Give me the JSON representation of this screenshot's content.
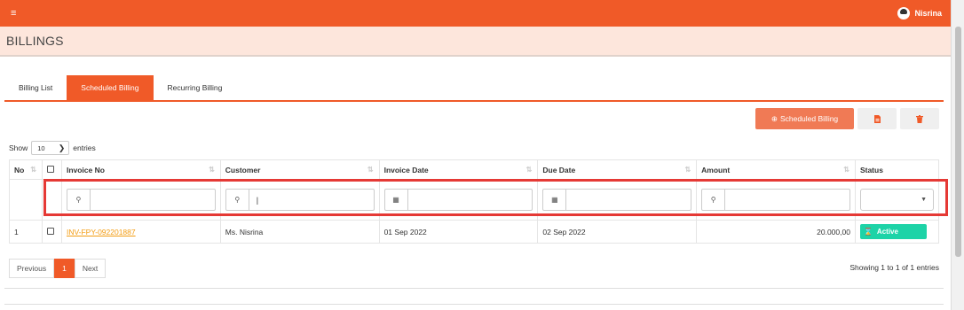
{
  "user": {
    "name": "Nisrina"
  },
  "page": {
    "title": "BILLINGS"
  },
  "tabs": [
    {
      "label": "Billing List",
      "active": false
    },
    {
      "label": "Scheduled Billing",
      "active": true
    },
    {
      "label": "Recurring Billing",
      "active": false
    }
  ],
  "actions": {
    "add_label": "Scheduled Billing",
    "add_icon": "plus-circle-icon",
    "pdf_icon": "pdf-icon",
    "delete_icon": "trash-icon"
  },
  "entries": {
    "show_label": "Show",
    "value": "10",
    "entries_label": "entries"
  },
  "table": {
    "headers": {
      "no": "No",
      "invoice_no": "Invoice No",
      "customer": "Customer",
      "invoice_date": "Invoice Date",
      "due_date": "Due Date",
      "amount": "Amount",
      "status": "Status"
    },
    "filters": {
      "customer_value": "|"
    },
    "rows": [
      {
        "no": "1",
        "invoice_no": "INV-FPY-092201887",
        "customer": "Ms. Nisrina",
        "invoice_date": "01 Sep 2022",
        "due_date": "02 Sep 2022",
        "amount": "20.000,00",
        "status": "Active"
      }
    ]
  },
  "pagination": {
    "previous": "Previous",
    "current": "1",
    "next": "Next",
    "showing": "Showing 1 to 1 of 1 entries"
  },
  "colors": {
    "brand": "#f05a28",
    "header_bg": "#fde6dc",
    "status_active": "#1dd3a7",
    "highlight": "#e53935"
  }
}
